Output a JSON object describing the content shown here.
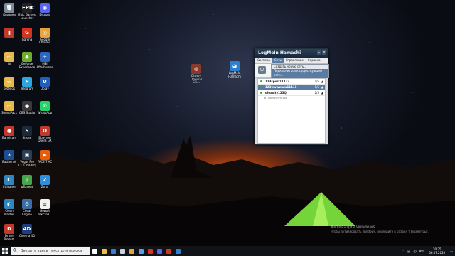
{
  "desktop_icons": [
    {
      "label": "Корзина",
      "color": "#7e8a96",
      "glyph": "🗑"
    },
    {
      "label": "Epic Games Launcher",
      "color": "#222222",
      "glyph": "EPIC"
    },
    {
      "label": "Discord",
      "color": "#5865f2",
      "glyph": "◉"
    },
    {
      "label": "",
      "color": "#c0392b",
      "glyph": "▮"
    },
    {
      "label": "Garena",
      "color": "#d4331d",
      "glyph": "G"
    },
    {
      "label": "Google Chrome",
      "color": "#e8a33d",
      "glyph": "◎"
    },
    {
      "label": "lol",
      "color": "#e5b94b",
      "glyph": "▭"
    },
    {
      "label": "GeForce Experience",
      "color": "#6dad2e",
      "glyph": "◆"
    },
    {
      "label": "MSI Afterburner",
      "color": "#2b66c1",
      "glyph": "✈"
    },
    {
      "label": "settings",
      "color": "#e5b94b",
      "glyph": "▭"
    },
    {
      "label": "Telegram",
      "color": "#2ca5e0",
      "glyph": "➤"
    },
    {
      "label": "Uplay",
      "color": "#1f5fbf",
      "glyph": "U"
    },
    {
      "label": "SoundPack",
      "color": "#e5b94b",
      "glyph": "▭"
    },
    {
      "label": "OBS Studio",
      "color": "#3a3a3a",
      "glyph": "●"
    },
    {
      "label": "WhatsApp",
      "color": "#25d366",
      "glyph": "✆"
    },
    {
      "label": "Bandicam",
      "color": "#c0392b",
      "glyph": "●"
    },
    {
      "label": "Steam",
      "color": "#1b2838",
      "glyph": "S"
    },
    {
      "label": "Браузер Opera GX",
      "color": "#c0392b",
      "glyph": "O"
    },
    {
      "label": "Battle.net",
      "color": "#1d4f8f",
      "glyph": "✶"
    },
    {
      "label": "Vegas Pro 13.0 (64-bit)",
      "color": "#2c3e50",
      "glyph": "▣"
    },
    {
      "label": "FACEIT AC",
      "color": "#e85d0a",
      "glyph": "▶"
    },
    {
      "label": "CCleaner",
      "color": "#2e86c1",
      "glyph": "C"
    },
    {
      "label": "µTorrent",
      "color": "#48a448",
      "glyph": "µ"
    },
    {
      "label": "Zona",
      "color": "#2f8fd8",
      "glyph": "Z"
    },
    {
      "label": "Clean Master",
      "color": "#2e86c1",
      "glyph": "◐"
    },
    {
      "label": "Cheat Engine",
      "color": "#3b6ea5",
      "glyph": "⚙"
    },
    {
      "label": "Новый текстов...",
      "color": "#f2f2f2",
      "glyph": "≡"
    },
    {
      "label": "Driver Booster",
      "color": "#c0392b",
      "glyph": "D"
    },
    {
      "label": "Cinema 4D",
      "color": "#1f3d7a",
      "glyph": "4D"
    }
  ],
  "floating_icons": [
    {
      "label": "Disney Original Sin...",
      "color": "#8b3a2a",
      "glyph": "◍"
    },
    {
      "label": "LogMeIn Hamachi",
      "color": "#2c7fd1",
      "glyph": "◕"
    }
  ],
  "hamachi": {
    "title": "LogMeIn Hamachi",
    "menu": [
      "Система",
      "Сеть",
      "Управление",
      "Справка"
    ],
    "active_menu_index": 1,
    "dropdown": [
      "Создать новую сеть...",
      "Подключиться к существующей сети..."
    ],
    "networks": [
      {
        "name": "123sporr11122",
        "count": "1/5",
        "selected": false
      },
      {
        "name": "123wwwwww11111",
        "count": "1/5",
        "selected": true
      },
      {
        "name": "dioaxlty123Q",
        "count": "2/5",
        "selected": false
      }
    ],
    "member": "HaMaShPro108"
  },
  "activation": {
    "title": "Активация Windows",
    "subtitle": "Чтобы активировать Windows, перейдите в раздел \"Параметры\"."
  },
  "taskbar": {
    "search_placeholder": "Введите здесь текст для поиска",
    "apps": [
      {
        "name": "task-view",
        "color": "#ffffff"
      },
      {
        "name": "explorer",
        "color": "#f0c040"
      },
      {
        "name": "store",
        "color": "#3a7bd5"
      },
      {
        "name": "steam",
        "color": "#c7d5e0"
      },
      {
        "name": "chrome",
        "color": "#e8a33d"
      },
      {
        "name": "mail",
        "color": "#5aa0e6"
      },
      {
        "name": "opera",
        "color": "#d9302a"
      },
      {
        "name": "discord",
        "color": "#5865f2"
      },
      {
        "name": "garena",
        "color": "#d4331d"
      },
      {
        "name": "hamachi",
        "color": "#2c7fd1"
      }
    ],
    "language": "РУС",
    "time": "20:35",
    "date": "06.07.2020"
  }
}
